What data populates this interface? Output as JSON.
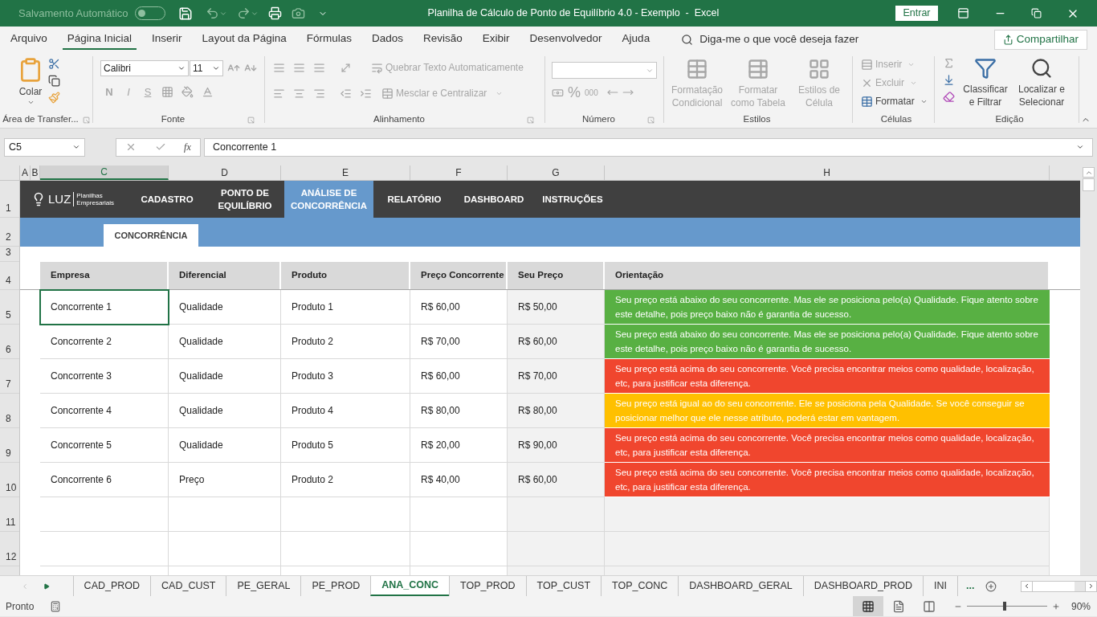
{
  "title_bar": {
    "autosave_label": "Salvamento Automático",
    "autosave_on": false,
    "title": "Planilha de Cálculo de Ponto de Equilíbrio 4.0 - Exemplo  -  Excel",
    "sign_in": "Entrar"
  },
  "menu": [
    {
      "label": "Arquivo",
      "selected": false
    },
    {
      "label": "Página Inicial",
      "selected": true
    },
    {
      "label": "Inserir",
      "selected": false
    },
    {
      "label": "Layout da Página",
      "selected": false
    },
    {
      "label": "Fórmulas",
      "selected": false
    },
    {
      "label": "Dados",
      "selected": false
    },
    {
      "label": "Revisão",
      "selected": false
    },
    {
      "label": "Exibir",
      "selected": false
    },
    {
      "label": "Desenvolvedor",
      "selected": false
    },
    {
      "label": "Ajuda",
      "selected": false
    }
  ],
  "tell_me": {
    "placeholder": "Diga-me o que você deseja fazer"
  },
  "share": "Compartilhar",
  "ribbon": {
    "clipboard": {
      "label": "Área de Transfer...",
      "paste": "Colar"
    },
    "font": {
      "label": "Fonte",
      "font_name": "Calibri",
      "font_size": "11",
      "styles": [
        {
          "label": "N",
          "disabled": true
        },
        {
          "label": "I",
          "disabled": true
        },
        {
          "label": "S",
          "disabled": true
        }
      ]
    },
    "alignment": {
      "label": "Alinhamento",
      "wrap": {
        "label": "Quebrar Texto Automaticamente",
        "disabled": true
      },
      "merge": {
        "label": "Mesclar e Centralizar",
        "disabled": true
      }
    },
    "number": {
      "label": "Número",
      "percent": "%",
      "thousands": "000",
      "disabled": true
    },
    "styles": {
      "label": "Estilos",
      "buttons": [
        {
          "label": "Formatação Condicional",
          "disabled": true
        },
        {
          "label": "Formatar como Tabela",
          "disabled": true
        },
        {
          "label": "Estilos de Célula",
          "disabled": true
        }
      ]
    },
    "cells": {
      "label": "Células",
      "buttons": [
        {
          "label": "Inserir",
          "disabled": true
        },
        {
          "label": "Excluir",
          "disabled": true
        },
        {
          "label": "Formatar",
          "disabled": false
        }
      ]
    },
    "editing": {
      "label": "Edição",
      "buttons": [
        {
          "label": "Classificar e Filtrar",
          "disabled": false
        },
        {
          "label": "Localizar e Selecionar",
          "disabled": false
        }
      ]
    }
  },
  "formula_bar": {
    "name_box": "C5",
    "fx": "fx",
    "value": "Concorrente 1"
  },
  "columns": [
    {
      "label": "A",
      "selected": false
    },
    {
      "label": "B",
      "selected": false
    },
    {
      "label": "C",
      "selected": true
    },
    {
      "label": "D",
      "selected": false
    },
    {
      "label": "E",
      "selected": false
    },
    {
      "label": "F",
      "selected": false
    },
    {
      "label": "G",
      "selected": false
    },
    {
      "label": "H",
      "selected": false
    }
  ],
  "row_numbers": [
    "1",
    "2",
    "3",
    "4",
    "5",
    "6",
    "7",
    "8",
    "9",
    "10",
    "11",
    "12"
  ],
  "nav": {
    "logo": "LUZ",
    "logo_sub": "Planilhas Empresariais",
    "items": [
      {
        "label": "CADASTRO",
        "selected": false
      },
      {
        "label": "PONTO DE EQUILÍBRIO",
        "selected": false
      },
      {
        "label": "ANÁLISE DE CONCORRÊNCIA",
        "selected": true
      },
      {
        "label": "RELATÓRIO",
        "selected": false
      },
      {
        "label": "DASHBOARD",
        "selected": false
      },
      {
        "label": "INSTRUÇÕES",
        "selected": false
      }
    ],
    "subtabs": [
      {
        "label": "CONCORRÊNCIA",
        "selected": true
      }
    ]
  },
  "table": {
    "columns": [
      "Empresa",
      "Diferencial",
      "Produto",
      "Preço Concorrente",
      "Seu Preço",
      "Orientação"
    ],
    "rows": [
      {
        "cells": [
          "Concorrente 1",
          "Qualidade",
          "Produto 1",
          "R$ 60,00",
          "R$ 50,00"
        ],
        "orientation": "Seu preço está abaixo do seu concorrente. Mas ele se posiciona pelo(a) Qualidade. Fique atento sobre este detalhe, pois preço baixo não é garantia de sucesso.",
        "color": "#58b043",
        "selected": true
      },
      {
        "cells": [
          "Concorrente 2",
          "Qualidade",
          "Produto 2",
          "R$ 70,00",
          "R$ 60,00"
        ],
        "orientation": "Seu preço está abaixo do seu concorrente. Mas ele se posiciona pelo(a) Qualidade. Fique atento sobre este detalhe, pois preço baixo não é garantia de sucesso.",
        "color": "#58b043",
        "selected": false
      },
      {
        "cells": [
          "Concorrente 3",
          "Qualidade",
          "Produto 3",
          "R$ 60,00",
          "R$ 70,00"
        ],
        "orientation": "Seu preço está acima do seu concorrente. Você precisa encontrar meios como qualidade, localização, etc, para justificar esta diferença.",
        "color": "#f0462e",
        "selected": false
      },
      {
        "cells": [
          "Concorrente 4",
          "Qualidade",
          "Produto 4",
          "R$ 80,00",
          "R$ 80,00"
        ],
        "orientation": "Seu preço está igual ao do seu concorrente. Ele se posiciona pela Qualidade. Se você conseguir se posicionar melhor que ele nesse atributo, poderá estar em vantagem.",
        "color": "#ffc000",
        "selected": false
      },
      {
        "cells": [
          "Concorrente 5",
          "Qualidade",
          "Produto 5",
          "R$ 20,00",
          "R$ 90,00"
        ],
        "orientation": "Seu preço está acima do seu concorrente. Você precisa encontrar meios como qualidade, localização, etc, para justificar esta diferença.",
        "color": "#f0462e",
        "selected": false
      },
      {
        "cells": [
          "Concorrente 6",
          "Preço",
          "Produto 2",
          "R$ 40,00",
          "R$ 60,00"
        ],
        "orientation": "Seu preço está acima do seu concorrente. Você precisa encontrar meios como qualidade, localização, etc, para justificar esta diferença.",
        "color": "#f0462e",
        "selected": false
      }
    ]
  },
  "sheet_tabs": [
    {
      "label": "CAD_PROD",
      "selected": false
    },
    {
      "label": "CAD_CUST",
      "selected": false
    },
    {
      "label": "PE_GERAL",
      "selected": false
    },
    {
      "label": "PE_PROD",
      "selected": false
    },
    {
      "label": "ANA_CONC",
      "selected": true
    },
    {
      "label": "TOP_PROD",
      "selected": false
    },
    {
      "label": "TOP_CUST",
      "selected": false
    },
    {
      "label": "TOP_CONC",
      "selected": false
    },
    {
      "label": "DASHBOARD_GERAL",
      "selected": false
    },
    {
      "label": "DASHBOARD_PROD",
      "selected": false
    },
    {
      "label": "INI",
      "selected": false
    }
  ],
  "more_tabs": "...",
  "status_bar": {
    "status": "Pronto",
    "views": [
      {
        "kind": "normal",
        "selected": true
      },
      {
        "kind": "page_layout",
        "selected": false
      },
      {
        "kind": "page_break",
        "selected": false
      }
    ],
    "zoom": {
      "level": 0.45,
      "reading": "90%"
    }
  }
}
